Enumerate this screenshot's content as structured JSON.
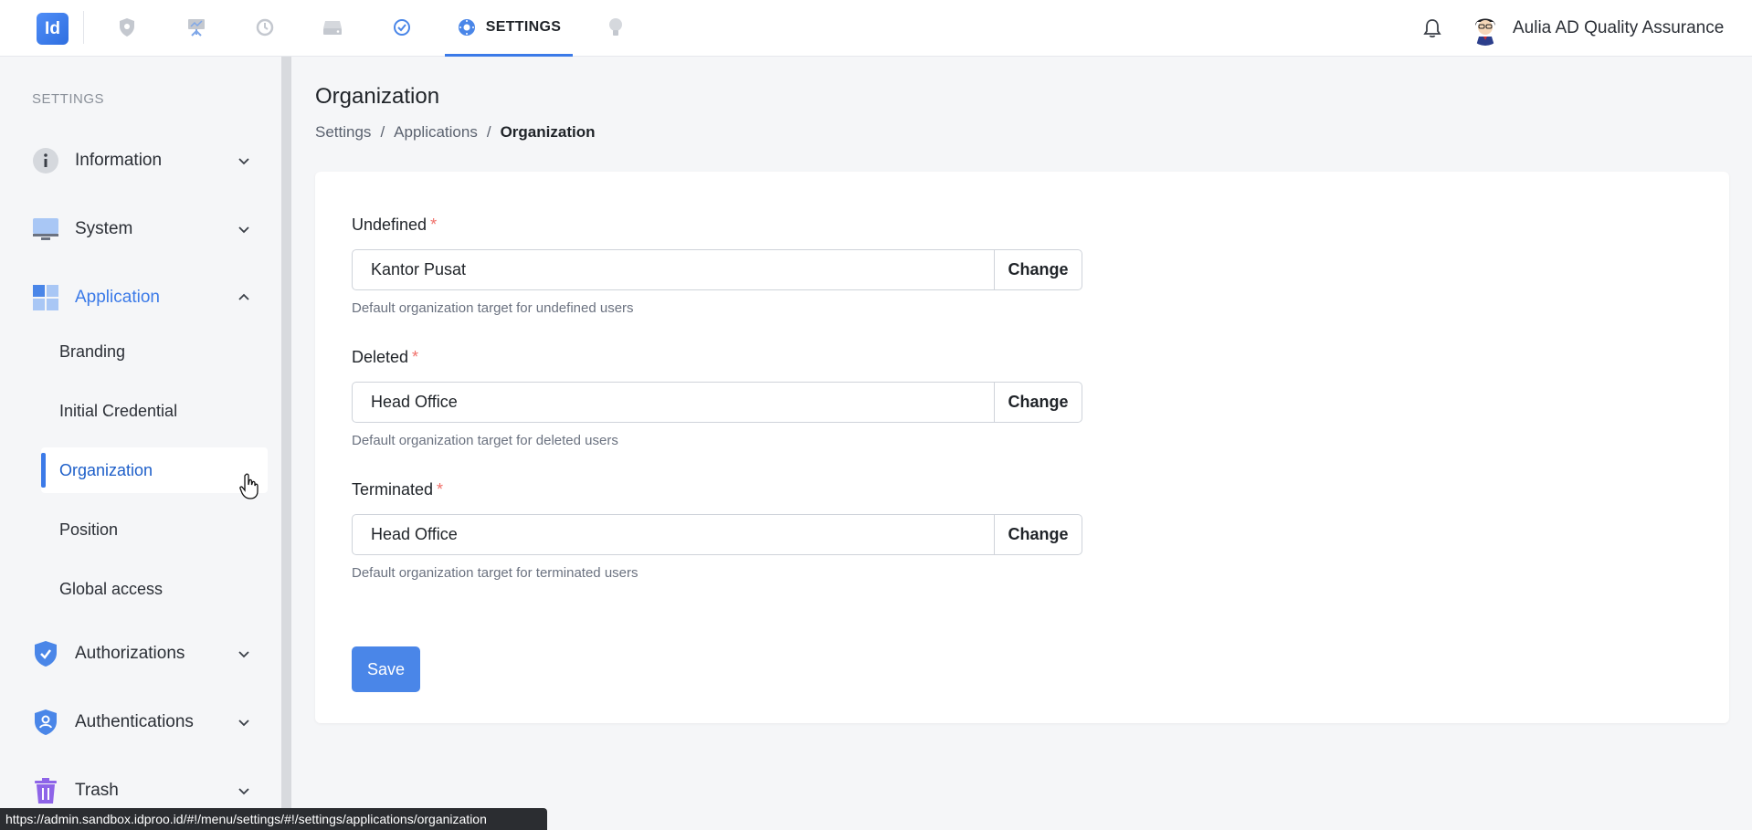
{
  "app": {
    "logo_text": "Id",
    "nav_tab_label": "SETTINGS",
    "user_name": "Aulia AD Quality Assurance"
  },
  "sidebar": {
    "heading": "SETTINGS",
    "groups": [
      {
        "label": "Information",
        "icon": "info-icon"
      },
      {
        "label": "System",
        "icon": "monitor-icon"
      },
      {
        "label": "Application",
        "icon": "grid-icon"
      },
      {
        "label": "Authorizations",
        "icon": "shield-check-icon"
      },
      {
        "label": "Authentications",
        "icon": "shield-user-icon"
      },
      {
        "label": "Trash",
        "icon": "trash-icon"
      }
    ],
    "application_items": [
      "Branding",
      "Initial Credential",
      "Organization",
      "Position",
      "Global access"
    ]
  },
  "main": {
    "title": "Organization",
    "breadcrumb": [
      "Settings",
      "Applications",
      "Organization"
    ],
    "fields": [
      {
        "label": "Undefined",
        "value": "Kantor Pusat",
        "button": "Change",
        "help": "Default organization target for undefined users"
      },
      {
        "label": "Deleted",
        "value": "Head Office",
        "button": "Change",
        "help": "Default organization target for deleted users"
      },
      {
        "label": "Terminated",
        "value": "Head Office",
        "button": "Change",
        "help": "Default organization target for terminated users"
      }
    ],
    "required_mark": "*",
    "save_label": "Save"
  },
  "statusbar": {
    "url": "https://admin.sandbox.idproo.id/#!/menu/settings/#!/settings/applications/organization"
  },
  "colors": {
    "accent": "#3b7ae8",
    "required": "#f0706a"
  }
}
